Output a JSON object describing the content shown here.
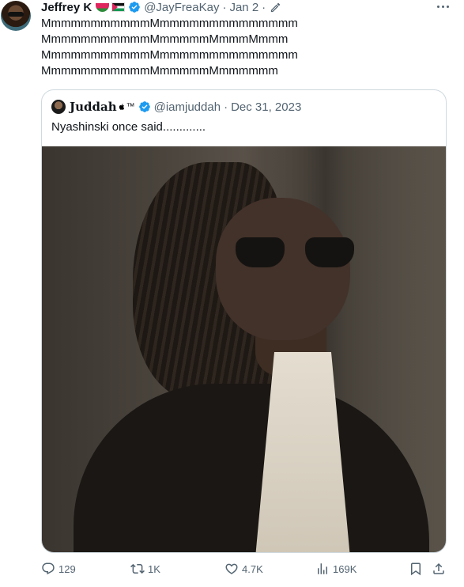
{
  "tweet": {
    "author_name": "Jeffrey K",
    "handle": "@JayFreaKay",
    "separator": "·",
    "date": "Jan 2",
    "lines": [
      "MmmmmmmmmmmMmmmmmmmmmmmmmm",
      "MmmmmmmmmmmMmmmmmMmmmMmmm",
      "MmmmmmmmmmmMmmmmmmmmmmmmmm",
      "MmmmmmmmmmmMmmmmmMmmmmmm"
    ]
  },
  "quote": {
    "author_name": "Juddah",
    "name_suffix": "™",
    "handle": "@iamjuddah",
    "separator": "·",
    "date": "Dec 31, 2023",
    "text": "Nyashinski once said............."
  },
  "actions": {
    "replies": "129",
    "reposts": "1K",
    "likes": "4.7K",
    "views": "169K"
  },
  "icons": {
    "verified_color": "#1d9bf0",
    "muted_color": "#536471"
  }
}
